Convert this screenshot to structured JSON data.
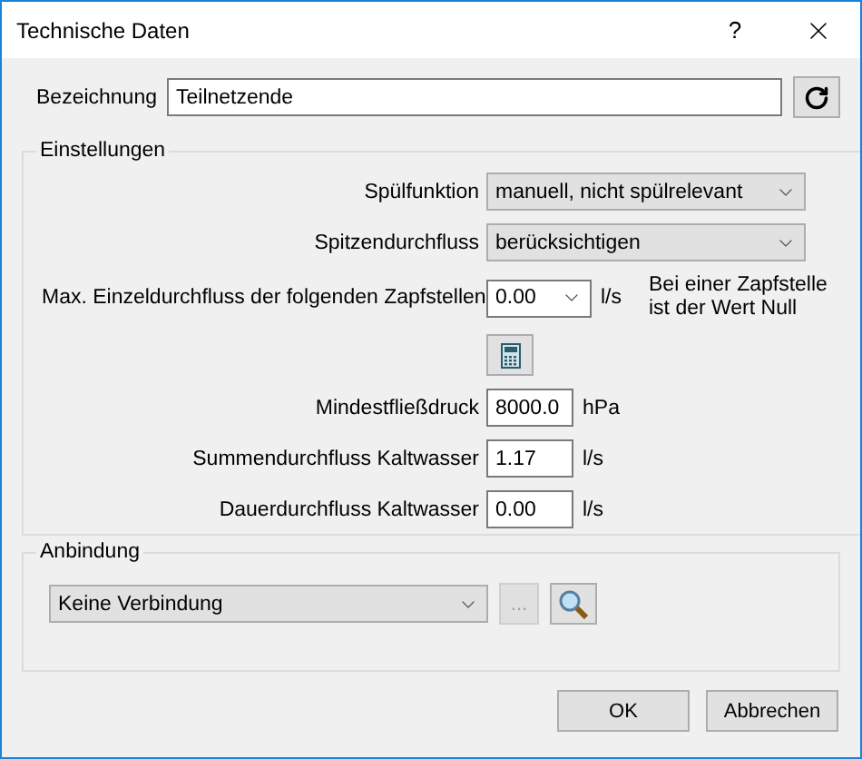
{
  "window": {
    "title": "Technische Daten",
    "help": "?"
  },
  "bezeichnung": {
    "label": "Bezeichnung",
    "value": "Teilnetzende"
  },
  "einstellungen": {
    "title": "Einstellungen",
    "rows": [
      {
        "kind": "select",
        "label": "Spülfunktion",
        "value": "manuell, nicht spülrelevant"
      },
      {
        "kind": "select",
        "label": "Spitzendurchfluss",
        "value": "berücksichtigen"
      },
      {
        "kind": "select_unit",
        "label": "Max. Einzeldurchfluss der folgenden Zapfstellen",
        "value": "0.00",
        "unit": "l/s",
        "note": "Bei einer Zapfstelle ist der Wert Null"
      },
      {
        "kind": "calc"
      },
      {
        "kind": "input",
        "label": "Mindestfließdruck",
        "value": "8000.0",
        "unit": "hPa"
      },
      {
        "kind": "input",
        "label": "Summendurchfluss Kaltwasser",
        "value": "1.17",
        "unit": "l/s"
      },
      {
        "kind": "input",
        "label": "Dauerdurchfluss Kaltwasser",
        "value": "0.00",
        "unit": "l/s"
      }
    ]
  },
  "anbindung": {
    "title": "Anbindung",
    "value": "Keine Verbindung",
    "buttons": [
      {
        "kind": "text",
        "label": "...",
        "disabled": true
      },
      {
        "kind": "search",
        "disabled": false
      }
    ]
  },
  "buttons": [
    "OK",
    "Abbrechen"
  ]
}
